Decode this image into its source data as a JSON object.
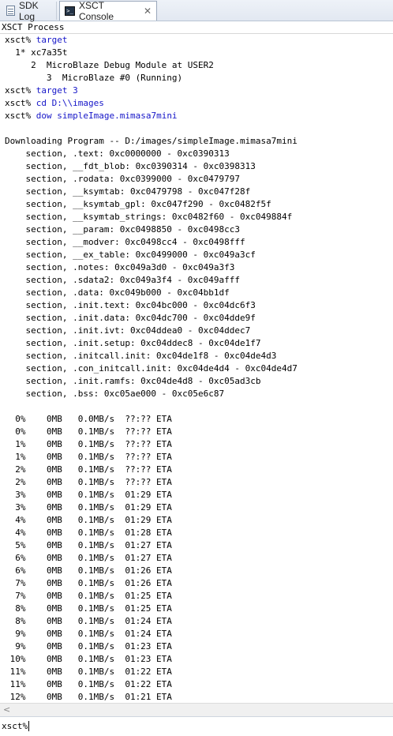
{
  "tabs": [
    {
      "label": "SDK Log",
      "icon": "log-icon"
    },
    {
      "label": "XSCT Console",
      "icon": "console-icon",
      "close": "✕"
    }
  ],
  "process_label": "XSCT Process",
  "console_lines": [
    {
      "type": "cmd",
      "prompt": "xsct% ",
      "text": "target"
    },
    {
      "type": "out",
      "text": "  1* xc7a35t"
    },
    {
      "type": "out",
      "text": "     2  MicroBlaze Debug Module at USER2"
    },
    {
      "type": "out",
      "text": "        3  MicroBlaze #0 (Running)"
    },
    {
      "type": "cmd",
      "prompt": "xsct% ",
      "text": "target 3"
    },
    {
      "type": "cmd",
      "prompt": "xsct% ",
      "text": "cd D:\\\\images"
    },
    {
      "type": "cmd",
      "prompt": "xsct% ",
      "text": "dow simpleImage.mimasa7mini"
    },
    {
      "type": "out",
      "text": ""
    },
    {
      "type": "out",
      "text": "Downloading Program -- D:/images/simpleImage.mimasa7mini"
    },
    {
      "type": "out",
      "text": "    section, .text: 0xc0000000 - 0xc0390313"
    },
    {
      "type": "out",
      "text": "    section, __fdt_blob: 0xc0390314 - 0xc0398313"
    },
    {
      "type": "out",
      "text": "    section, .rodata: 0xc0399000 - 0xc0479797"
    },
    {
      "type": "out",
      "text": "    section, __ksymtab: 0xc0479798 - 0xc047f28f"
    },
    {
      "type": "out",
      "text": "    section, __ksymtab_gpl: 0xc047f290 - 0xc0482f5f"
    },
    {
      "type": "out",
      "text": "    section, __ksymtab_strings: 0xc0482f60 - 0xc049884f"
    },
    {
      "type": "out",
      "text": "    section, __param: 0xc0498850 - 0xc0498cc3"
    },
    {
      "type": "out",
      "text": "    section, __modver: 0xc0498cc4 - 0xc0498fff"
    },
    {
      "type": "out",
      "text": "    section, __ex_table: 0xc0499000 - 0xc049a3cf"
    },
    {
      "type": "out",
      "text": "    section, .notes: 0xc049a3d0 - 0xc049a3f3"
    },
    {
      "type": "out",
      "text": "    section, .sdata2: 0xc049a3f4 - 0xc049afff"
    },
    {
      "type": "out",
      "text": "    section, .data: 0xc049b000 - 0xc04bb1df"
    },
    {
      "type": "out",
      "text": "    section, .init.text: 0xc04bc000 - 0xc04dc6f3"
    },
    {
      "type": "out",
      "text": "    section, .init.data: 0xc04dc700 - 0xc04dde9f"
    },
    {
      "type": "out",
      "text": "    section, .init.ivt: 0xc04ddea0 - 0xc04ddec7"
    },
    {
      "type": "out",
      "text": "    section, .init.setup: 0xc04ddec8 - 0xc04de1f7"
    },
    {
      "type": "out",
      "text": "    section, .initcall.init: 0xc04de1f8 - 0xc04de4d3"
    },
    {
      "type": "out",
      "text": "    section, .con_initcall.init: 0xc04de4d4 - 0xc04de4d7"
    },
    {
      "type": "out",
      "text": "    section, .init.ramfs: 0xc04de4d8 - 0xc05ad3cb"
    },
    {
      "type": "out",
      "text": "    section, .bss: 0xc05ae000 - 0xc05e6c87"
    },
    {
      "type": "out",
      "text": ""
    },
    {
      "type": "out",
      "text": "  0%    0MB   0.0MB/s  ??:?? ETA"
    },
    {
      "type": "out",
      "text": "  0%    0MB   0.1MB/s  ??:?? ETA"
    },
    {
      "type": "out",
      "text": "  1%    0MB   0.1MB/s  ??:?? ETA"
    },
    {
      "type": "out",
      "text": "  1%    0MB   0.1MB/s  ??:?? ETA"
    },
    {
      "type": "out",
      "text": "  2%    0MB   0.1MB/s  ??:?? ETA"
    },
    {
      "type": "out",
      "text": "  2%    0MB   0.1MB/s  ??:?? ETA"
    },
    {
      "type": "out",
      "text": "  3%    0MB   0.1MB/s  01:29 ETA"
    },
    {
      "type": "out",
      "text": "  3%    0MB   0.1MB/s  01:29 ETA"
    },
    {
      "type": "out",
      "text": "  4%    0MB   0.1MB/s  01:29 ETA"
    },
    {
      "type": "out",
      "text": "  4%    0MB   0.1MB/s  01:28 ETA"
    },
    {
      "type": "out",
      "text": "  5%    0MB   0.1MB/s  01:27 ETA"
    },
    {
      "type": "out",
      "text": "  6%    0MB   0.1MB/s  01:27 ETA"
    },
    {
      "type": "out",
      "text": "  6%    0MB   0.1MB/s  01:26 ETA"
    },
    {
      "type": "out",
      "text": "  7%    0MB   0.1MB/s  01:26 ETA"
    },
    {
      "type": "out",
      "text": "  7%    0MB   0.1MB/s  01:25 ETA"
    },
    {
      "type": "out",
      "text": "  8%    0MB   0.1MB/s  01:25 ETA"
    },
    {
      "type": "out",
      "text": "  8%    0MB   0.1MB/s  01:24 ETA"
    },
    {
      "type": "out",
      "text": "  9%    0MB   0.1MB/s  01:24 ETA"
    },
    {
      "type": "out",
      "text": "  9%    0MB   0.1MB/s  01:23 ETA"
    },
    {
      "type": "out",
      "text": " 10%    0MB   0.1MB/s  01:23 ETA"
    },
    {
      "type": "out",
      "text": " 11%    0MB   0.1MB/s  01:22 ETA"
    },
    {
      "type": "out",
      "text": " 11%    0MB   0.1MB/s  01:22 ETA"
    },
    {
      "type": "out",
      "text": " 12%    0MB   0.1MB/s  01:21 ETA"
    }
  ],
  "scrollbar": {
    "left_arrow": "<"
  },
  "input": {
    "prompt": "xsct%",
    "value": ""
  },
  "colors": {
    "command": "#1515c8",
    "output": "#000000"
  }
}
